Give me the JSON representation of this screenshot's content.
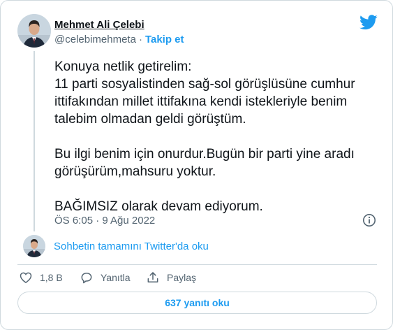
{
  "author": {
    "display_name": "Mehmet Ali Çelebi",
    "handle": "@celebimehmeta",
    "follow_label": "Takip et"
  },
  "tweet": {
    "paragraphs": [
      "Konuya netlik getirelim:\n11 parti sosyalistinden sağ-sol görüşlüsüne cumhur ittifakından millet ittifakına kendi istekleriyle benim talebim olmadan geldi görüştüm.",
      "Bu ilgi benim için onurdur.Bugün bir parti yine aradı görüşürüm,mahsuru yoktur.",
      "BAĞIMSIZ olarak devam ediyorum."
    ],
    "timestamp": "ÖS 6:05 · 9 Ağu 2022"
  },
  "thread_link": "Sohbetin tamamını Twitter'da oku",
  "actions": {
    "like_count": "1,8 B",
    "reply_label": "Yanıtla",
    "share_label": "Paylaş"
  },
  "replies_button": "637 yanıtı oku",
  "colors": {
    "accent": "#1d9bf0",
    "text": "#0f1419",
    "secondary": "#536471",
    "border": "#cfd9de"
  },
  "icons": [
    "twitter-bird-icon",
    "info-icon",
    "heart-icon",
    "reply-icon",
    "share-icon"
  ]
}
